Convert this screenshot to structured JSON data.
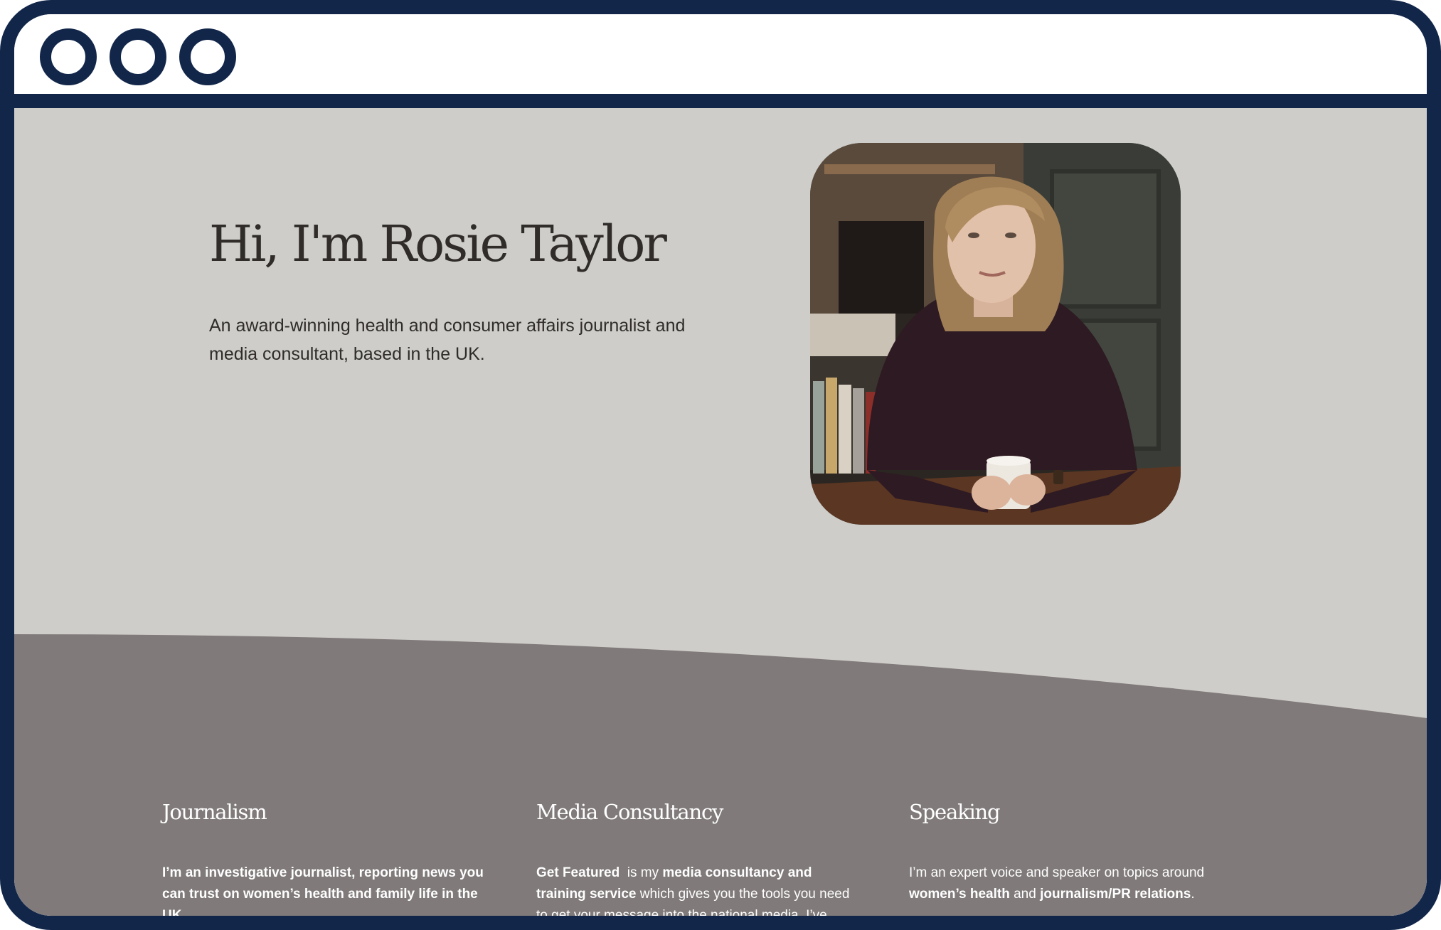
{
  "window": {
    "controls": [
      "circle-control",
      "circle-control",
      "circle-control"
    ],
    "frame_color": "#12264a"
  },
  "hero": {
    "title": "Hi, I'm Rosie Taylor",
    "subtitle": "An award-winning health and consumer affairs journalist and media consultant, based in the UK.",
    "portrait_icon": "portrait-photo"
  },
  "colors": {
    "hero_bg": "#cecdc9",
    "services_bg": "#807a7a",
    "text_dark": "#2f2c2a",
    "text_light": "#ffffff"
  },
  "services": [
    {
      "title": "Journalism",
      "body": [
        {
          "text": "I’m an investigative journalist, reporting news you can trust on women’s health and family life in the UK.",
          "bold": true
        }
      ]
    },
    {
      "title": "Media Consultancy",
      "body": [
        {
          "text": "Get Featured",
          "bold": true
        },
        {
          "text": "  is my ",
          "bold": false
        },
        {
          "text": "media consultancy and training service",
          "bold": true
        },
        {
          "text": " which gives you the tools you need to get your message into the national media. I’ve",
          "bold": false
        }
      ]
    },
    {
      "title": "Speaking",
      "body": [
        {
          "text": "I’m an expert voice and speaker on topics around ",
          "bold": false
        },
        {
          "text": "women’s health",
          "bold": true
        },
        {
          "text": " and ",
          "bold": false
        },
        {
          "text": "journalism/PR relations",
          "bold": true
        },
        {
          "text": ".",
          "bold": false
        }
      ]
    }
  ]
}
